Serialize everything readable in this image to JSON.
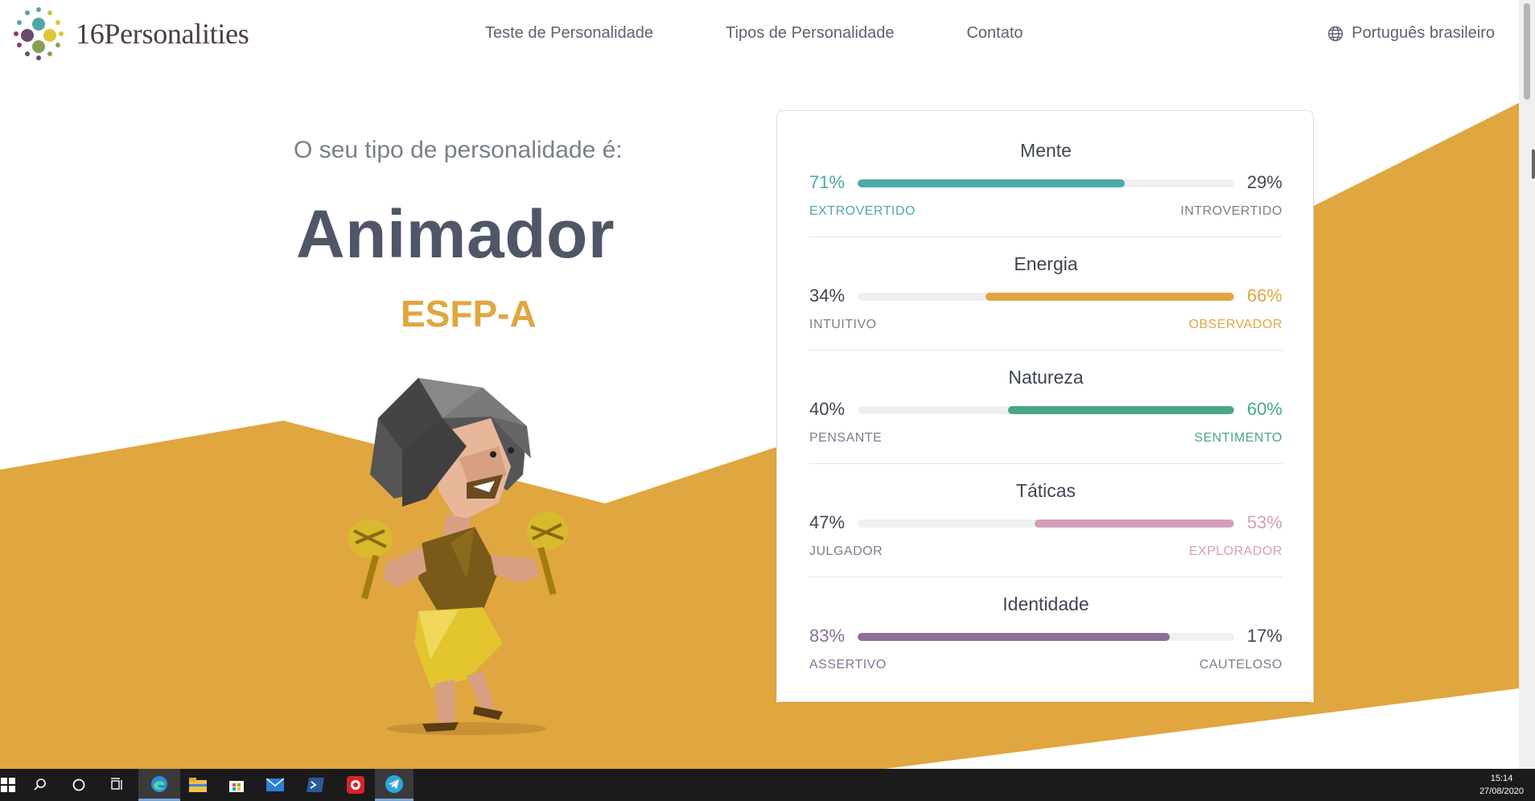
{
  "header": {
    "brand": "16Personalities",
    "nav": [
      {
        "label": "Teste de Personalidade"
      },
      {
        "label": "Tipos de Personalidade"
      },
      {
        "label": "Contato"
      }
    ],
    "language": "Português brasileiro",
    "language_icon": "globe-icon"
  },
  "result": {
    "intro": "O seu tipo de personalidade é:",
    "type_name": "Animador",
    "type_code": "ESFP-A"
  },
  "traits": [
    {
      "title": "Mente",
      "left_pct": "71%",
      "right_pct": "29%",
      "left_label": "EXTROVERTIDO",
      "right_label": "INTROVERTIDO",
      "value": 71,
      "dominant": "left",
      "color": "#4fa8a8"
    },
    {
      "title": "Energia",
      "left_pct": "34%",
      "right_pct": "66%",
      "left_label": "INTUITIVO",
      "right_label": "OBSERVADOR",
      "value": 66,
      "dominant": "right",
      "color": "#e0a63f"
    },
    {
      "title": "Natureza",
      "left_pct": "40%",
      "right_pct": "60%",
      "left_label": "PENSANTE",
      "right_label": "SENTIMENTO",
      "value": 60,
      "dominant": "right",
      "color": "#4aa786"
    },
    {
      "title": "Táticas",
      "left_pct": "47%",
      "right_pct": "53%",
      "left_label": "JULGADOR",
      "right_label": "EXPLORADOR",
      "value": 53,
      "dominant": "right",
      "color": "#d39fb7"
    },
    {
      "title": "Identidade",
      "left_pct": "83%",
      "right_pct": "17%",
      "left_label": "ASSERTIVO",
      "right_label": "CAUTELOSO",
      "value": 83,
      "dominant": "left",
      "color": "#8a7197"
    }
  ],
  "colors": {
    "accent": "#e0a63f",
    "background_shape": "#e0a63f",
    "neutral_text": "#5d6372"
  },
  "taskbar": {
    "icons": [
      "windows-start-icon",
      "search-icon",
      "cortana-icon",
      "task-view-icon",
      "edge-icon",
      "file-explorer-icon",
      "store-icon",
      "mail-icon",
      "powershell-icon",
      "screen-recorder-icon",
      "telegram-icon"
    ],
    "time": "15:14",
    "date": "27/08/2020"
  }
}
